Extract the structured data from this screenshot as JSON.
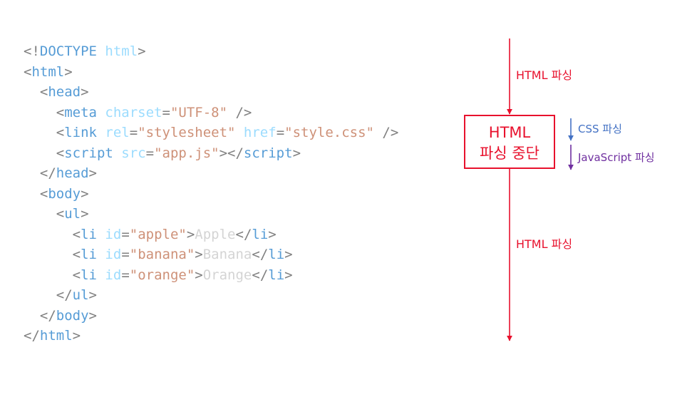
{
  "code": {
    "lines": [
      [
        {
          "t": "<!",
          "c": "br"
        },
        {
          "t": "DOCTYPE",
          "c": "doc"
        },
        {
          "t": " html",
          "c": "attr"
        },
        {
          "t": ">",
          "c": "br"
        }
      ],
      [
        {
          "t": "<",
          "c": "br"
        },
        {
          "t": "html",
          "c": "tag"
        },
        {
          "t": ">",
          "c": "br"
        }
      ],
      [
        {
          "t": "  ",
          "c": "text"
        },
        {
          "t": "<",
          "c": "br"
        },
        {
          "t": "head",
          "c": "tag"
        },
        {
          "t": ">",
          "c": "br"
        }
      ],
      [
        {
          "t": "    ",
          "c": "text"
        },
        {
          "t": "<",
          "c": "br"
        },
        {
          "t": "meta",
          "c": "tag"
        },
        {
          "t": " charset",
          "c": "attr"
        },
        {
          "t": "=",
          "c": "br"
        },
        {
          "t": "\"UTF-8\"",
          "c": "val"
        },
        {
          "t": " />",
          "c": "br"
        }
      ],
      [
        {
          "t": "    ",
          "c": "text"
        },
        {
          "t": "<",
          "c": "br"
        },
        {
          "t": "link",
          "c": "tag"
        },
        {
          "t": " rel",
          "c": "attr"
        },
        {
          "t": "=",
          "c": "br"
        },
        {
          "t": "\"stylesheet\"",
          "c": "val"
        },
        {
          "t": " href",
          "c": "attr"
        },
        {
          "t": "=",
          "c": "br"
        },
        {
          "t": "\"style.css\"",
          "c": "val"
        },
        {
          "t": " />",
          "c": "br"
        }
      ],
      [
        {
          "t": "    ",
          "c": "text"
        },
        {
          "t": "<",
          "c": "br"
        },
        {
          "t": "script",
          "c": "tag"
        },
        {
          "t": " src",
          "c": "attr"
        },
        {
          "t": "=",
          "c": "br"
        },
        {
          "t": "\"app.js\"",
          "c": "val"
        },
        {
          "t": "></",
          "c": "br"
        },
        {
          "t": "script",
          "c": "tag"
        },
        {
          "t": ">",
          "c": "br"
        }
      ],
      [
        {
          "t": "  ",
          "c": "text"
        },
        {
          "t": "</",
          "c": "br"
        },
        {
          "t": "head",
          "c": "tag"
        },
        {
          "t": ">",
          "c": "br"
        }
      ],
      [
        {
          "t": "  ",
          "c": "text"
        },
        {
          "t": "<",
          "c": "br"
        },
        {
          "t": "body",
          "c": "tag"
        },
        {
          "t": ">",
          "c": "br"
        }
      ],
      [
        {
          "t": "    ",
          "c": "text"
        },
        {
          "t": "<",
          "c": "br"
        },
        {
          "t": "ul",
          "c": "tag"
        },
        {
          "t": ">",
          "c": "br"
        }
      ],
      [
        {
          "t": "      ",
          "c": "text"
        },
        {
          "t": "<",
          "c": "br"
        },
        {
          "t": "li",
          "c": "tag"
        },
        {
          "t": " id",
          "c": "attr"
        },
        {
          "t": "=",
          "c": "br"
        },
        {
          "t": "\"apple\"",
          "c": "val"
        },
        {
          "t": ">",
          "c": "br"
        },
        {
          "t": "Apple",
          "c": "text"
        },
        {
          "t": "</",
          "c": "br"
        },
        {
          "t": "li",
          "c": "tag"
        },
        {
          "t": ">",
          "c": "br"
        }
      ],
      [
        {
          "t": "      ",
          "c": "text"
        },
        {
          "t": "<",
          "c": "br"
        },
        {
          "t": "li",
          "c": "tag"
        },
        {
          "t": " id",
          "c": "attr"
        },
        {
          "t": "=",
          "c": "br"
        },
        {
          "t": "\"banana\"",
          "c": "val"
        },
        {
          "t": ">",
          "c": "br"
        },
        {
          "t": "Banana",
          "c": "text"
        },
        {
          "t": "</",
          "c": "br"
        },
        {
          "t": "li",
          "c": "tag"
        },
        {
          "t": ">",
          "c": "br"
        }
      ],
      [
        {
          "t": "      ",
          "c": "text"
        },
        {
          "t": "<",
          "c": "br"
        },
        {
          "t": "li",
          "c": "tag"
        },
        {
          "t": " id",
          "c": "attr"
        },
        {
          "t": "=",
          "c": "br"
        },
        {
          "t": "\"orange\"",
          "c": "val"
        },
        {
          "t": ">",
          "c": "br"
        },
        {
          "t": "Orange",
          "c": "text"
        },
        {
          "t": "</",
          "c": "br"
        },
        {
          "t": "li",
          "c": "tag"
        },
        {
          "t": ">",
          "c": "br"
        }
      ],
      [
        {
          "t": "    ",
          "c": "text"
        },
        {
          "t": "</",
          "c": "br"
        },
        {
          "t": "ul",
          "c": "tag"
        },
        {
          "t": ">",
          "c": "br"
        }
      ],
      [
        {
          "t": "  ",
          "c": "text"
        },
        {
          "t": "</",
          "c": "br"
        },
        {
          "t": "body",
          "c": "tag"
        },
        {
          "t": ">",
          "c": "br"
        }
      ],
      [
        {
          "t": "</",
          "c": "br"
        },
        {
          "t": "html",
          "c": "tag"
        },
        {
          "t": ">",
          "c": "br"
        }
      ]
    ]
  },
  "diagram": {
    "parse_label_top": "HTML 파싱",
    "stop_box_line1": "HTML",
    "stop_box_line2": "파싱 중단",
    "css_label": "CSS 파싱",
    "js_label": "JavaScript 파싱",
    "parse_label_bottom": "HTML 파싱",
    "colors": {
      "html": "#e8112d",
      "css": "#4472c4",
      "js": "#7030a0"
    }
  }
}
